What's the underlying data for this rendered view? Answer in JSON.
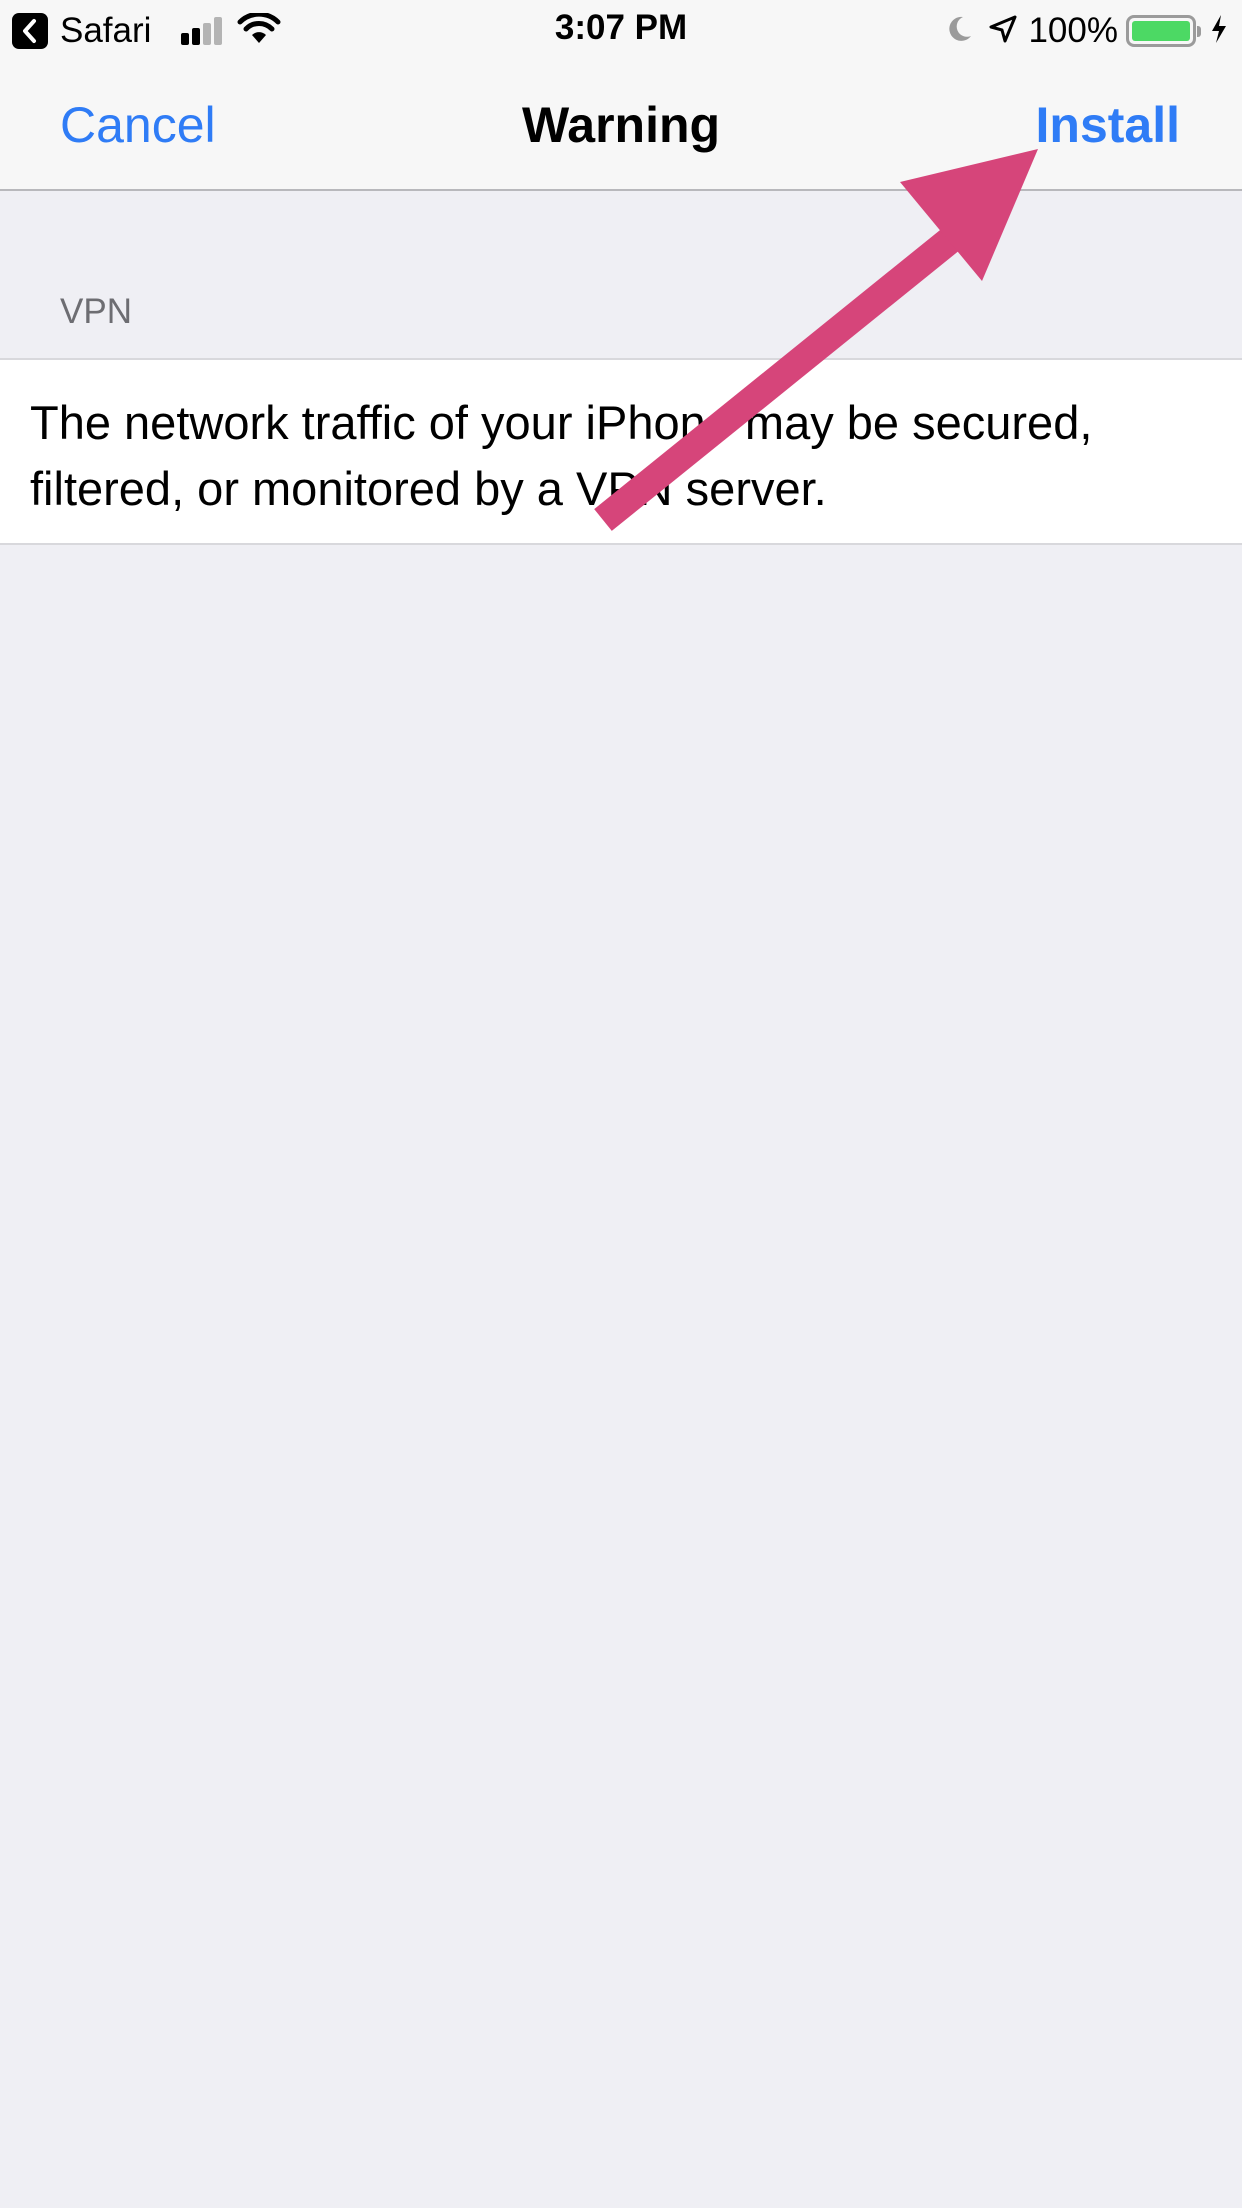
{
  "status_bar": {
    "back_app": "Safari",
    "time": "3:07 PM",
    "battery_percent": "100%",
    "battery_level": 1.0,
    "signal_bars_active": 2,
    "signal_bars_total": 4,
    "icons": [
      "back-chevron-icon",
      "cellular-signal-icon",
      "wifi-icon",
      "moon-icon",
      "location-arrow-icon",
      "battery-icon",
      "charging-bolt-icon"
    ]
  },
  "nav": {
    "cancel_label": "Cancel",
    "title": "Warning",
    "install_label": "Install"
  },
  "section": {
    "header": "VPN",
    "body": "The network traffic of your iPhone may be secured, filtered, or monitored by a VPN server."
  },
  "colors": {
    "accent": "#2f7cf6",
    "background": "#efeff4",
    "annotation_arrow": "#d6457a",
    "battery_fill": "#4cd964"
  }
}
